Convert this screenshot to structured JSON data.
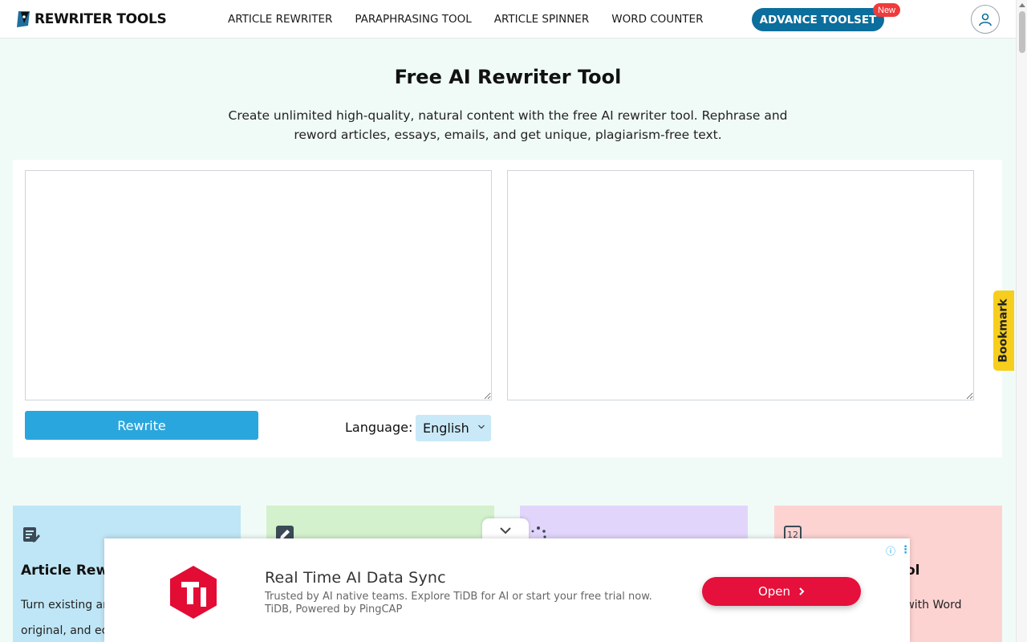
{
  "brand": {
    "name": "REWRITER TOOLS"
  },
  "nav": {
    "links": [
      "ARTICLE REWRITER",
      "PARAPHRASING TOOL",
      "ARTICLE SPINNER",
      "WORD COUNTER"
    ],
    "advance_label": "ADVANCE TOOLSET",
    "new_badge": "New"
  },
  "header": {
    "title": "Free AI Rewriter Tool",
    "subtitle": "Create unlimited high-quality, natural content with the free AI rewriter tool. Rephrase and reword articles, essays, emails, and get unique, plagiarism-free text."
  },
  "tool": {
    "input_value": "",
    "output_value": "",
    "rewrite_label": "Rewrite",
    "language_label": "Language:",
    "language_value": "English"
  },
  "cards": [
    {
      "title": "Article Rewr",
      "lines": [
        "Turn existing ar",
        "original, and ec"
      ]
    },
    {
      "title": "",
      "lines": []
    },
    {
      "title": "",
      "lines": []
    },
    {
      "title": "ol",
      "lines": [
        "g with Word"
      ]
    }
  ],
  "bookmark": {
    "label": "Bookmark"
  },
  "ad": {
    "title": "Real Time AI Data Sync",
    "description": "Trusted by AI native teams. Explore TiDB for AI or start your free trial now. TiDB, Powered by PingCAP",
    "button_label": "Open"
  },
  "colors": {
    "page_bg": "#f0fbf7",
    "accent_button": "#2aa6de",
    "advance_button": "#0b6e9c",
    "new_badge": "#ef3b3b",
    "bookmark": "#f7ce1d",
    "ad_button": "#e5103b",
    "card_blue": "#bfe6f6",
    "card_green": "#d3f1cc",
    "card_purple": "#e2d5fb",
    "card_red": "#fdd3d2"
  },
  "icons": [
    "pen-logo-icon",
    "user-avatar-icon",
    "chevron-down-icon",
    "document-edit-icon",
    "pencil-icon",
    "spinner-dots-icon",
    "word-count-icon",
    "tidb-logo-icon",
    "chevron-right-icon",
    "info-icon",
    "more-vertical-icon"
  ]
}
